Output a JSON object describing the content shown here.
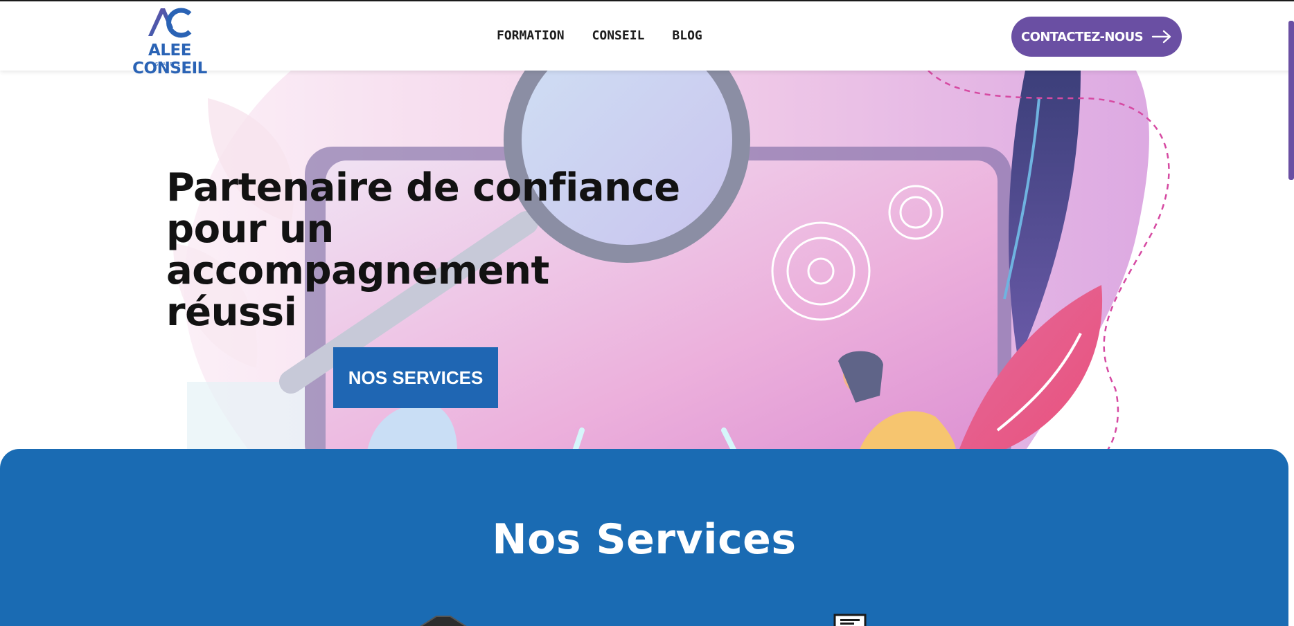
{
  "header": {
    "logo": {
      "mark": "AC",
      "name": "ALEE CONSEIL",
      "sub": "SARL"
    },
    "nav": [
      {
        "label": "FORMATION"
      },
      {
        "label": "CONSEIL"
      },
      {
        "label": "BLOG"
      }
    ],
    "cta_label": "CONTACTEZ-NOUS",
    "cta_icon": "arrow-right-icon"
  },
  "hero": {
    "title_lines": [
      "Partenaire de confiance",
      "pour un accompagnement",
      "réussi"
    ],
    "button_label": "NOS SERVICES"
  },
  "services": {
    "title": "Nos Services",
    "icons": [
      "laptop-icon",
      "document-icon"
    ]
  },
  "colors": {
    "brand_blue": "#1a6bb3",
    "button_blue": "#1f66b3",
    "cta_purple": "#6a4fa3",
    "logo_blue": "#2a63b5"
  }
}
